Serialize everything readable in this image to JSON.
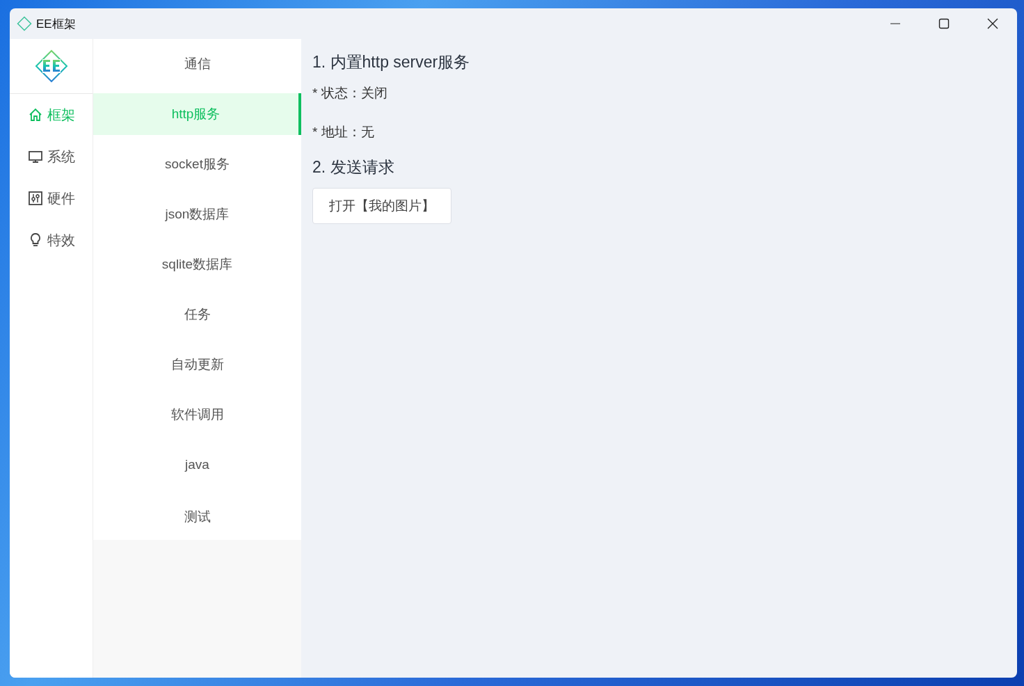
{
  "window": {
    "title": "EE框架"
  },
  "sidebar": {
    "items": [
      {
        "label": "框架",
        "selected": true
      },
      {
        "label": "系统",
        "selected": false
      },
      {
        "label": "硬件",
        "selected": false
      },
      {
        "label": "特效",
        "selected": false
      }
    ]
  },
  "submenu": {
    "items": [
      {
        "label": "通信",
        "selected": false
      },
      {
        "label": "http服务",
        "selected": true
      },
      {
        "label": "socket服务",
        "selected": false
      },
      {
        "label": "json数据库",
        "selected": false
      },
      {
        "label": "sqlite数据库",
        "selected": false
      },
      {
        "label": "任务",
        "selected": false
      },
      {
        "label": "自动更新",
        "selected": false
      },
      {
        "label": "软件调用",
        "selected": false
      },
      {
        "label": "java",
        "selected": false
      },
      {
        "label": "测试",
        "selected": false
      }
    ]
  },
  "content": {
    "sections": [
      {
        "heading": "1. 内置http server服务",
        "lines": [
          "* 状态：关闭",
          "* 地址：无"
        ]
      },
      {
        "heading": "2. 发送请求",
        "buttons": [
          "打开【我的图片】"
        ]
      }
    ]
  }
}
